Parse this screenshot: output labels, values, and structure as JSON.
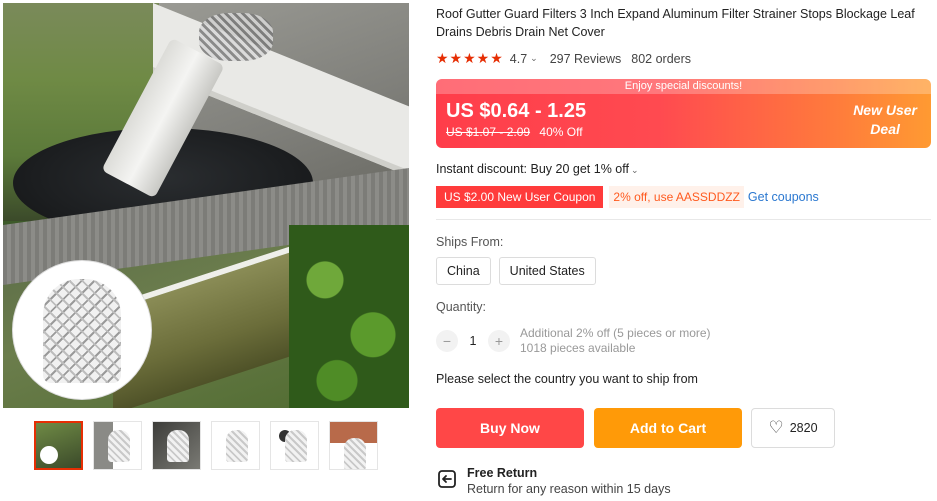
{
  "product": {
    "title": "Roof Gutter Guard Filters 3 Inch Expand Aluminum Filter Strainer Stops Blockage Leaf Drains Debris Drain Net Cover"
  },
  "rating": {
    "stars": "★★★★★",
    "score": "4.7",
    "reviews": "297 Reviews",
    "orders": "802 orders"
  },
  "price": {
    "banner": "Enjoy special discounts!",
    "current": "US $0.64 - 1.25",
    "original": "US $1.07 - 2.09",
    "discount": "40% Off",
    "badge_line1": "New User",
    "badge_line2": "Deal"
  },
  "instant_discount": "Instant discount: Buy 20 get 1% off",
  "coupons": {
    "new_user": "US $2.00 New User Coupon",
    "code": "2% off, use AASSDDZZ",
    "get": "Get coupons"
  },
  "shipping": {
    "label": "Ships From:",
    "options": [
      "China",
      "United States"
    ]
  },
  "quantity": {
    "label": "Quantity:",
    "minus": "−",
    "value": "1",
    "plus": "+",
    "note_line1": "Additional 2% off (5 pieces or more)",
    "note_line2": "1018 pieces available"
  },
  "ship_message": "Please select the country you want to ship from",
  "actions": {
    "buy_now": "Buy Now",
    "add_to_cart": "Add to Cart",
    "wishlist_count": "2820"
  },
  "free_return": {
    "title": "Free Return",
    "detail": "Return for any reason within 15 days"
  },
  "colors": {
    "accent_red": "#ff4747",
    "accent_orange": "#ff9a08",
    "link_blue": "#2b78d0"
  }
}
